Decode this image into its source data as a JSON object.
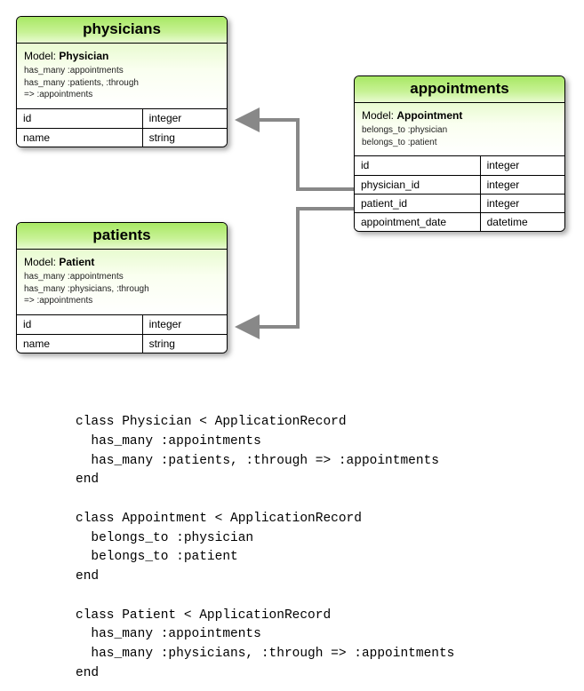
{
  "entities": {
    "physicians": {
      "title": "physicians",
      "model_prefix": "Model: ",
      "model_name": "Physician",
      "relations": [
        "has_many :appointments",
        "has_many :patients, :through",
        "=> :appointments"
      ],
      "columns": [
        {
          "name": "id",
          "type": "integer"
        },
        {
          "name": "name",
          "type": "string"
        }
      ]
    },
    "patients": {
      "title": "patients",
      "model_prefix": "Model: ",
      "model_name": "Patient",
      "relations": [
        "has_many :appointments",
        "has_many :physicians, :through",
        "=> :appointments"
      ],
      "columns": [
        {
          "name": "id",
          "type": "integer"
        },
        {
          "name": "name",
          "type": "string"
        }
      ]
    },
    "appointments": {
      "title": "appointments",
      "model_prefix": "Model: ",
      "model_name": "Appointment",
      "relations": [
        "belongs_to :physician",
        "belongs_to :patient"
      ],
      "columns": [
        {
          "name": "id",
          "type": "integer"
        },
        {
          "name": "physician_id",
          "type": "integer"
        },
        {
          "name": "patient_id",
          "type": "integer"
        },
        {
          "name": "appointment_date",
          "type": "datetime"
        }
      ]
    }
  },
  "code": "class Physician < ApplicationRecord\n  has_many :appointments\n  has_many :patients, :through => :appointments\nend\n\nclass Appointment < ApplicationRecord\n  belongs_to :physician\n  belongs_to :patient\nend\n\nclass Patient < ApplicationRecord\n  has_many :appointments\n  has_many :physicians, :through => :appointments\nend"
}
